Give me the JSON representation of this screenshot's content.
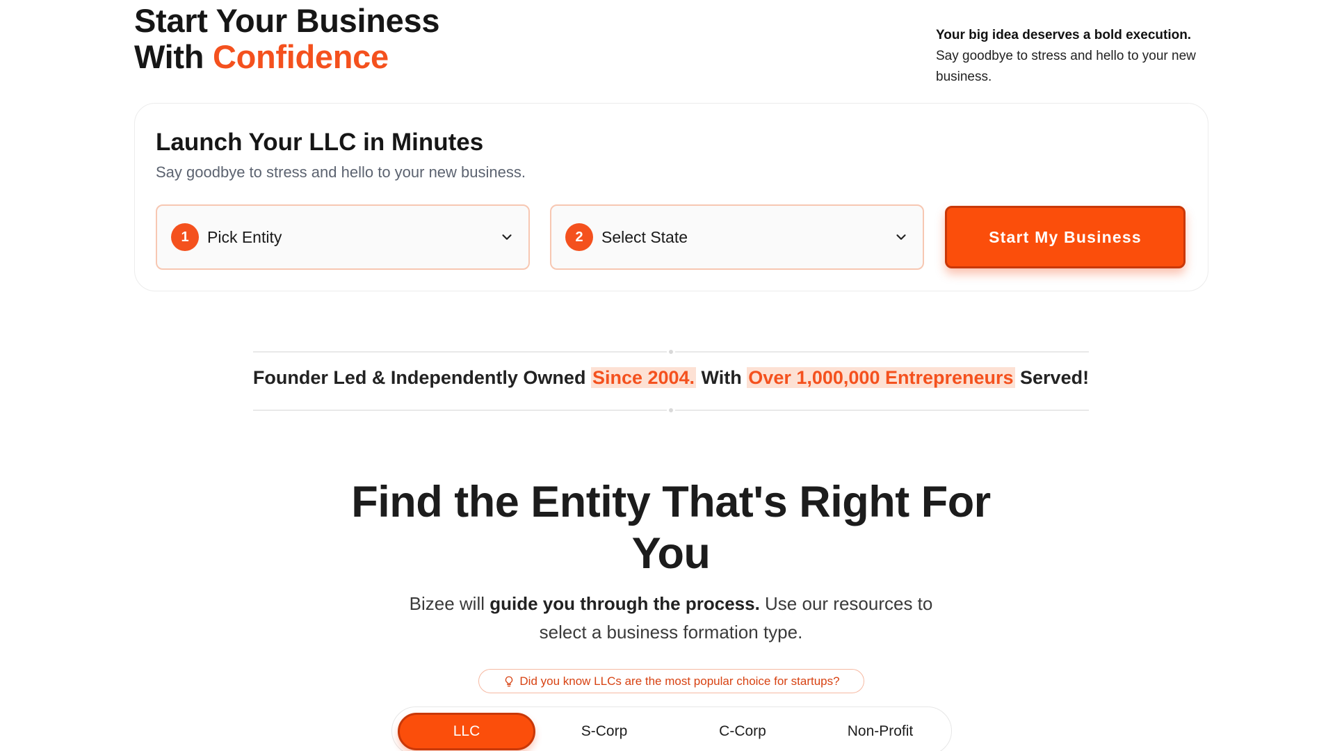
{
  "hero": {
    "title_line1": "Start Your Business",
    "title_line2_prefix": "With ",
    "title_line2_accent": "Confidence",
    "side_bold": "Your big idea deserves a bold execution.",
    "side_text": "Say goodbye to stress and hello to your new business."
  },
  "launch": {
    "title": "Launch Your LLC in Minutes",
    "subtitle": "Say goodbye to stress and hello to your new business.",
    "entity_step": "1",
    "entity_label": "Pick Entity",
    "state_step": "2",
    "state_label": "Select State",
    "cta_label": "Start My Business"
  },
  "founder": {
    "part1": "Founder Led & Independently Owned ",
    "highlight1": "Since 2004.",
    "part2": " With ",
    "highlight2": "Over 1,000,000 Entrepreneurs",
    "part3": " Served!"
  },
  "entity": {
    "heading": "Find the Entity That's Right For You",
    "desc_prefix": "Bizee will ",
    "desc_bold": "guide you through the process.",
    "desc_suffix": " Use our resources to select a business formation type.",
    "tip": "Did you know LLCs are the most popular choice for startups?",
    "tabs": [
      "LLC",
      "S-Corp",
      "C-Corp",
      "Non-Profit"
    ],
    "active_tab": "LLC"
  },
  "colors": {
    "accent": "#f4511e",
    "button": "#fb4e0b",
    "highlight_bg": "#fde1d4"
  },
  "icons": {
    "select_chevron": "chevron-down-icon",
    "tip_icon": "lightbulb-icon"
  }
}
